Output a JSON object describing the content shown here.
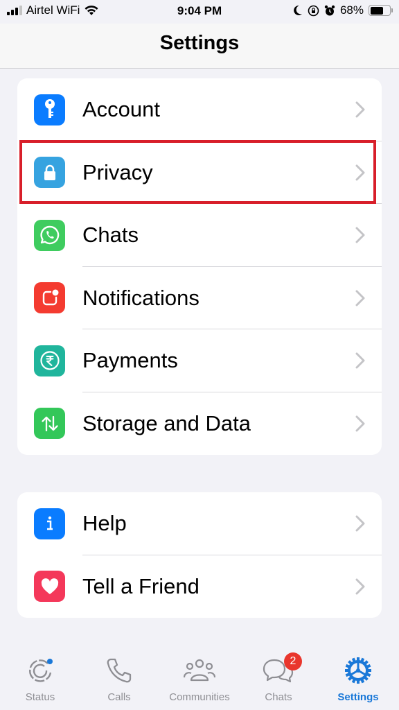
{
  "status_bar": {
    "carrier": "Airtel WiFi",
    "time": "9:04 PM",
    "battery_percent": "68%",
    "battery_level": 0.68
  },
  "header": {
    "title": "Settings"
  },
  "sections": [
    {
      "items": [
        {
          "label": "Account",
          "icon": "key-icon",
          "color": "#0a7cff"
        },
        {
          "label": "Privacy",
          "icon": "lock-icon",
          "color": "#36a3e0",
          "highlighted": true
        },
        {
          "label": "Chats",
          "icon": "whatsapp-icon",
          "color": "#3fcc5f"
        },
        {
          "label": "Notifications",
          "icon": "notification-icon",
          "color": "#f43b30"
        },
        {
          "label": "Payments",
          "icon": "rupee-icon",
          "color": "#20b59c"
        },
        {
          "label": "Storage and Data",
          "icon": "arrows-updown-icon",
          "color": "#33c759"
        }
      ]
    },
    {
      "items": [
        {
          "label": "Help",
          "icon": "info-icon",
          "color": "#0a7cff"
        },
        {
          "label": "Tell a Friend",
          "icon": "heart-icon",
          "color": "#f4385a"
        }
      ]
    }
  ],
  "tab_bar": {
    "tabs": [
      {
        "label": "Status",
        "icon": "status-icon"
      },
      {
        "label": "Calls",
        "icon": "phone-icon"
      },
      {
        "label": "Communities",
        "icon": "communities-icon"
      },
      {
        "label": "Chats",
        "icon": "chat-bubbles-icon",
        "badge": "2"
      },
      {
        "label": "Settings",
        "icon": "settings-gear-icon",
        "active": true
      }
    ]
  },
  "colors": {
    "accent": "#1a78d8",
    "highlight_box": "#d81f2a",
    "badge": "#e9362d"
  }
}
